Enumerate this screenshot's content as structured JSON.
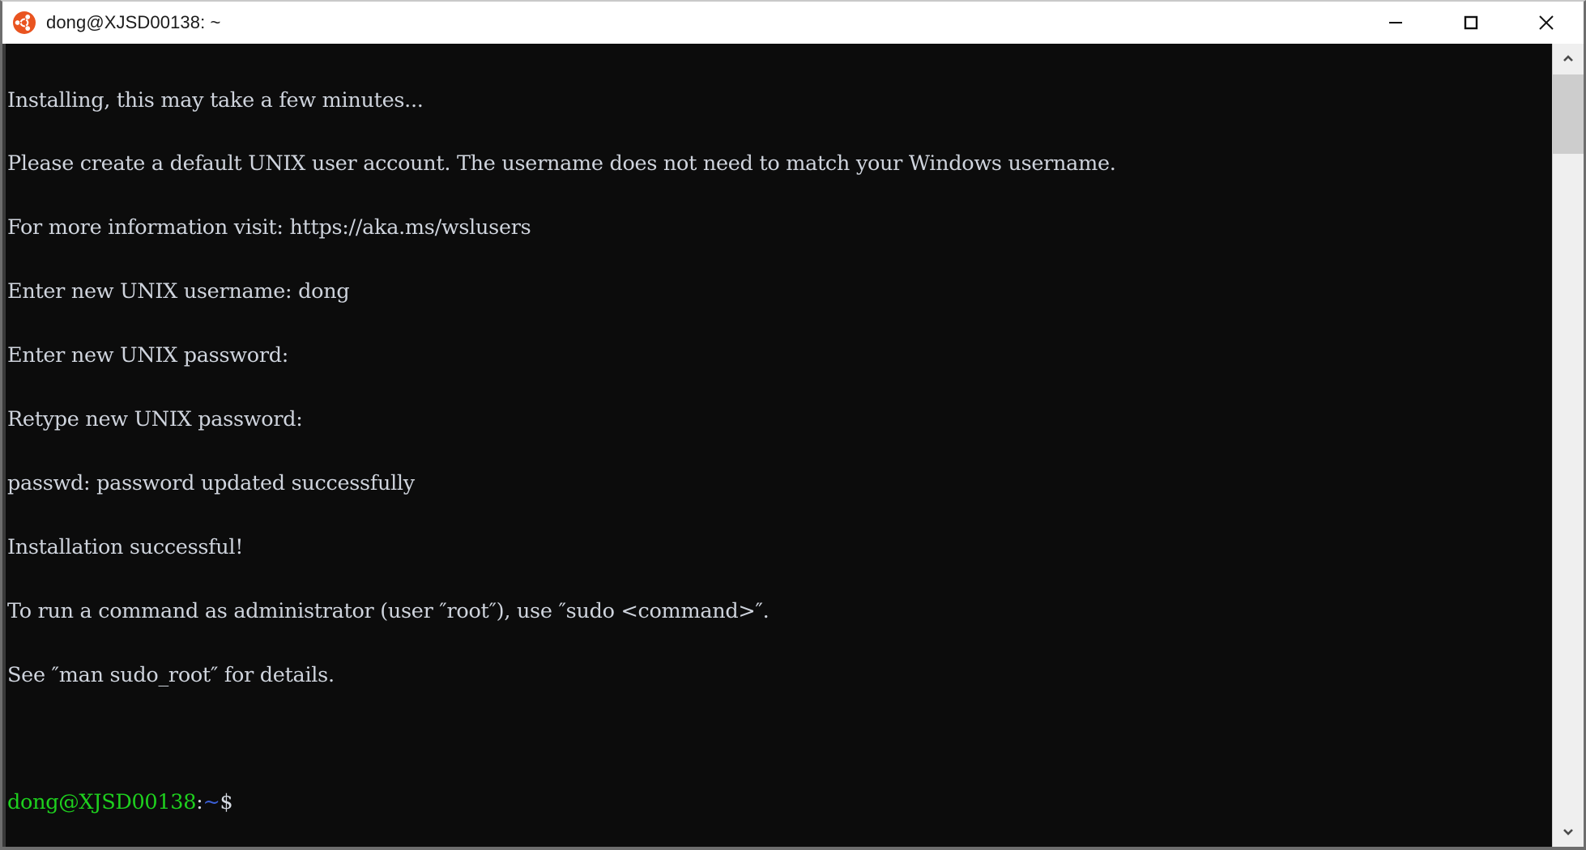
{
  "window": {
    "title": "dong@XJSD00138: ~",
    "app_icon": "ubuntu-logo-icon",
    "brand_color": "#E95420",
    "background": "#0c0c0c",
    "controls": {
      "minimize_label": "Minimize",
      "maximize_label": "Maximize",
      "close_label": "Close"
    }
  },
  "terminal": {
    "foreground": "#cfd4dd",
    "prompt_user_color": "#1ed01e",
    "prompt_path_color": "#3b5fd6",
    "lines": [
      "Installing, this may take a few minutes...",
      "Please create a default UNIX user account. The username does not need to match your Windows username.",
      "For more information visit: https://aka.ms/wslusers",
      "Enter new UNIX username: dong",
      "Enter new UNIX password:",
      "Retype new UNIX password:",
      "passwd: password updated successfully",
      "Installation successful!",
      "To run a command as administrator (user ″root″), use ″sudo <command>″.",
      "See ″man sudo_root″ for details.",
      ""
    ],
    "prompt": {
      "user_host": "dong@XJSD00138",
      "separator": ":",
      "path": "~",
      "sigil": "$"
    }
  },
  "scrollbar": {
    "up_arrow_icon": "chevron-up-icon",
    "down_arrow_icon": "chevron-down-icon",
    "thumb_position_percent": 0,
    "thumb_size_percent": 10
  }
}
